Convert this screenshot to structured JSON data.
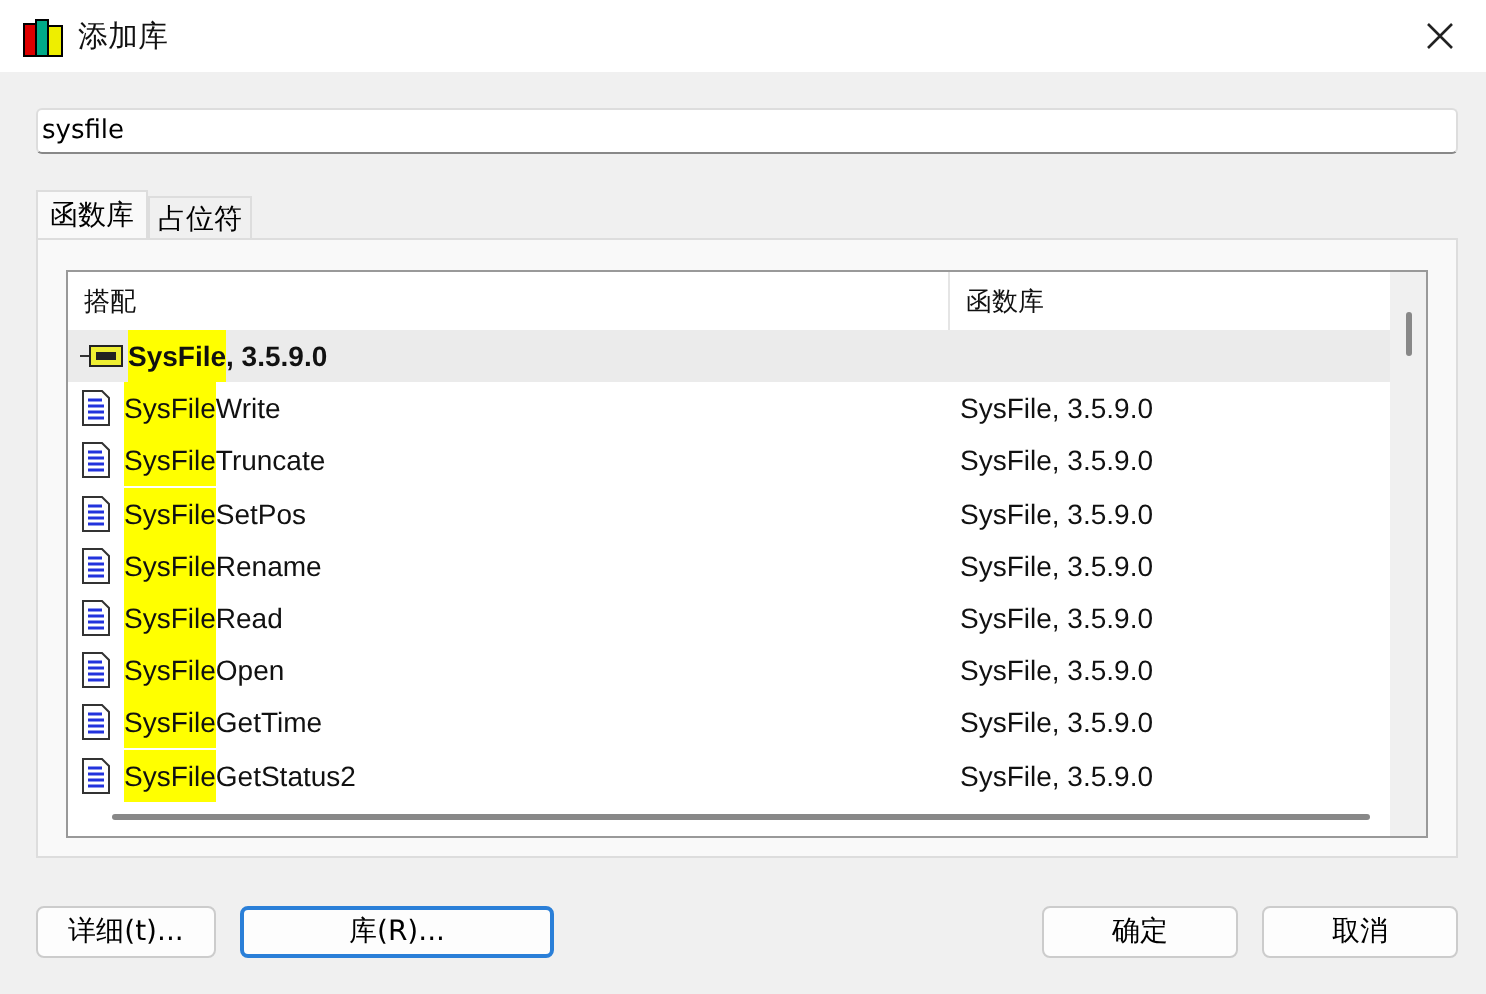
{
  "window": {
    "title": "添加库"
  },
  "search": {
    "value": "sysfile"
  },
  "tabs": [
    {
      "label": "函数库",
      "selected": true
    },
    {
      "label": "占位符",
      "selected": false
    }
  ],
  "table": {
    "columns": [
      "搭配",
      "函数库"
    ],
    "rows": [
      {
        "kind": "library",
        "match": "SysFile",
        "rest": ", 3.5.9.0",
        "library": "",
        "selected": true
      },
      {
        "kind": "function",
        "match": "SysFile",
        "rest": "Write",
        "library": "SysFile, 3.5.9.0",
        "selected": false
      },
      {
        "kind": "function",
        "match": "SysFile",
        "rest": "Truncate",
        "library": "SysFile, 3.5.9.0",
        "selected": false
      },
      {
        "kind": "function",
        "match": "SysFile",
        "rest": "SetPos",
        "library": "SysFile, 3.5.9.0",
        "selected": false
      },
      {
        "kind": "function",
        "match": "SysFile",
        "rest": "Rename",
        "library": "SysFile, 3.5.9.0",
        "selected": false
      },
      {
        "kind": "function",
        "match": "SysFile",
        "rest": "Read",
        "library": "SysFile, 3.5.9.0",
        "selected": false
      },
      {
        "kind": "function",
        "match": "SysFile",
        "rest": "Open",
        "library": "SysFile, 3.5.9.0",
        "selected": false
      },
      {
        "kind": "function",
        "match": "SysFile",
        "rest": "GetTime",
        "library": "SysFile, 3.5.9.0",
        "selected": false
      },
      {
        "kind": "function",
        "match": "SysFile",
        "rest": "GetStatus2",
        "library": "SysFile, 3.5.9.0",
        "selected": false
      }
    ]
  },
  "buttons_left": [
    {
      "label": "详细(t)...",
      "focused": false
    },
    {
      "label": "库(R)...",
      "focused": true
    }
  ],
  "buttons_right": [
    {
      "label": "确定",
      "focused": false
    },
    {
      "label": "取消",
      "focused": false
    }
  ]
}
